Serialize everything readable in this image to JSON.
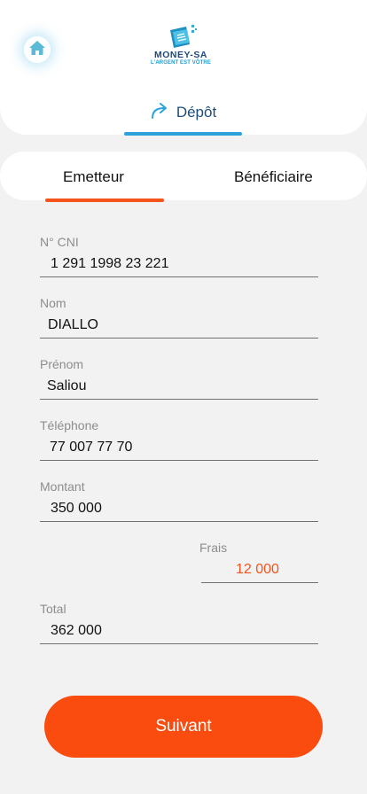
{
  "header": {
    "logo_name": "MONEY-SA",
    "logo_tagline": "L'ARGENT EST VÔTRE",
    "active_tab_label": "Dépôt"
  },
  "party_tabs": [
    {
      "label": "Emetteur",
      "active": true
    },
    {
      "label": "Bénéficiaire",
      "active": false
    }
  ],
  "form": {
    "cni": {
      "label": "N° CNI",
      "value": "1 291 1998 23 221"
    },
    "nom": {
      "label": "Nom",
      "value": "DIALLO"
    },
    "prenom": {
      "label": "Prénom",
      "value": "Saliou"
    },
    "telephone": {
      "label": "Téléphone",
      "value": "77 007 77 70"
    },
    "montant": {
      "label": "Montant",
      "value": "350 000"
    },
    "frais": {
      "label": "Frais",
      "value": "12 000"
    },
    "total": {
      "label": "Total",
      "value": "362 000"
    }
  },
  "actions": {
    "next_label": "Suivant"
  },
  "colors": {
    "accent_orange": "#f94c0e",
    "accent_blue": "#2aa3dc",
    "frais_value": "#f4541c",
    "brand_navy": "#1f4a7a"
  },
  "icons": {
    "home": "home-icon",
    "depot": "redo-arrow-icon",
    "logo": "money-logo-icon"
  }
}
